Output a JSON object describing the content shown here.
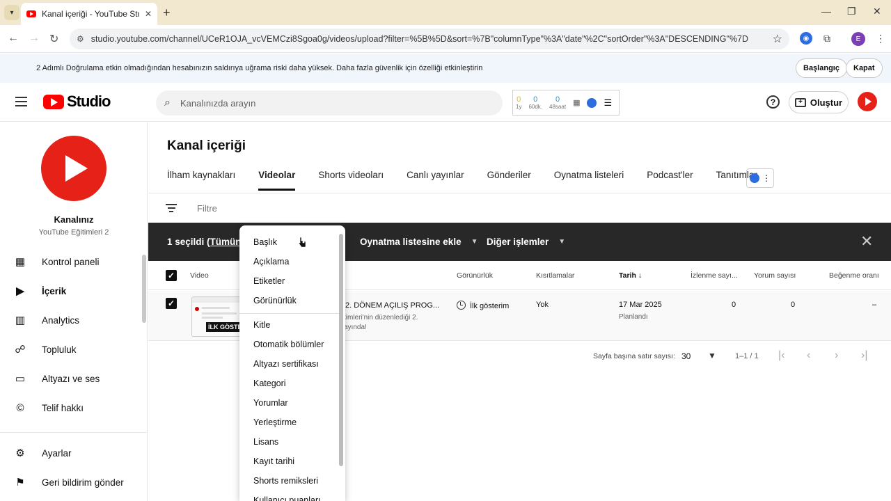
{
  "browser": {
    "tab_title": "Kanal içeriği - YouTube Studio",
    "url": "studio.youtube.com/channel/UCeR1OJA_vcVEMCzi8Sgoa0g/videos/upload?filter=%5B%5D&sort=%7B\"columnType\"%3A\"date\"%2C\"sortOrder\"%3A\"DESCENDING\"%7D",
    "profile_initial": "E"
  },
  "notice": {
    "text": "2 Adımlı Doğrulama etkin olmadığından hesabınızın saldırıya uğrama riski daha yüksek. Daha fazla güvenlik için özelliği etkinleştirin",
    "start_label": "Başlangıç",
    "close_label": "Kapat"
  },
  "header": {
    "logo_text": "Studio",
    "search_placeholder": "Kanalınızda arayın",
    "stats": [
      {
        "value": "0",
        "label": "1y",
        "color": "#f2b600"
      },
      {
        "value": "0",
        "label": "60dk.",
        "color": "#1a9ad6"
      },
      {
        "value": "0",
        "label": "48saat",
        "color": "#1a9ad6"
      }
    ],
    "create_label": "Oluştur"
  },
  "sidebar": {
    "channel_name": "Kanalınız",
    "channel_sub": "YouTube Eğitimleri 2",
    "items": [
      {
        "label": "Kontrol paneli",
        "icon": "dashboard-icon"
      },
      {
        "label": "İçerik",
        "icon": "content-icon"
      },
      {
        "label": "Analytics",
        "icon": "analytics-icon"
      },
      {
        "label": "Topluluk",
        "icon": "community-icon"
      },
      {
        "label": "Altyazı ve ses",
        "icon": "subtitles-icon"
      },
      {
        "label": "Telif hakkı",
        "icon": "copyright-icon"
      }
    ],
    "bottom": [
      {
        "label": "Ayarlar",
        "icon": "settings-icon"
      },
      {
        "label": "Geri bildirim gönder",
        "icon": "feedback-icon"
      }
    ]
  },
  "main": {
    "title": "Kanal içeriği",
    "tabs": [
      "İlham kaynakları",
      "Videolar",
      "Shorts videoları",
      "Canlı yayınlar",
      "Gönderiler",
      "Oynatma listeleri",
      "Podcast'ler",
      "Tanıtımlar"
    ],
    "active_tab": "Videolar",
    "filter_placeholder": "Filtre",
    "selection": {
      "selected_text": "1 seçildi (",
      "select_all_text": "Tümünü s",
      "add_playlist": "Oynatma listesine ekle",
      "more_actions": "Diğer işlemler"
    },
    "columns": {
      "video": "Video",
      "visibility": "Görünürlük",
      "restrictions": "Kısıtlamalar",
      "date": "Tarih",
      "views": "İzlenme sayı...",
      "comments": "Yorum sayısı",
      "likes": "Beğenme oranı"
    },
    "rows": [
      {
        "thumb_badge": "İLK GÖSTE",
        "title": "2. DÖNEM AÇILIŞ PROG...",
        "desc_line1": "timleri'nin düzenlediği 2.",
        "desc_line2": "ayında!",
        "visibility": "İlk gösterim",
        "restrictions": "Yok",
        "date": "17 Mar 2025",
        "date_status": "Planlandı",
        "views": "0",
        "comments": "0",
        "likes": "–"
      }
    ],
    "pagination": {
      "rows_label": "Sayfa başına satır sayısı:",
      "rows_value": "30",
      "range": "1–1 / 1"
    }
  },
  "dropdown": {
    "items_top": [
      "Başlık",
      "Açıklama",
      "Etiketler",
      "Görünürlük"
    ],
    "items_bottom": [
      "Kitle",
      "Otomatik bölümler",
      "Altyazı sertifikası",
      "Kategori",
      "Yorumlar",
      "Yerleştirme",
      "Lisans",
      "Kayıt tarihi",
      "Shorts remiksleri",
      "Kullanıcı puanları"
    ]
  }
}
